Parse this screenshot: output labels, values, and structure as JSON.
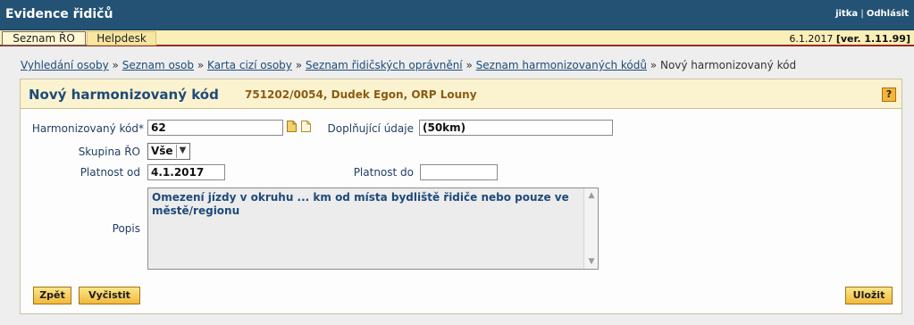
{
  "app": {
    "title": "Evidence řidičů",
    "user": "jitka",
    "separator": "|",
    "logout_label": "Odhlásit"
  },
  "menu": {
    "items": [
      {
        "label": "Seznam ŘO",
        "active": true
      },
      {
        "label": "Helpdesk",
        "active": false
      }
    ],
    "date": "6.1.2017",
    "version": "[ver. 1.11.99]"
  },
  "breadcrumb": {
    "links": [
      "Vyhledání osoby",
      "Seznam osob",
      "Karta cizí osoby",
      "Seznam řidičských oprávnění",
      "Seznam harmonizovaných kódů"
    ],
    "separator": "»",
    "current": "Nový harmonizovaný kód"
  },
  "panel": {
    "title": "Nový harmonizovaný kód",
    "subtitle": "751202/0054, Dudek Egon, ORP Louny",
    "help_label": "?"
  },
  "form": {
    "harmonized_code": {
      "label": "Harmonizovaný kód*",
      "value": "62"
    },
    "extra_info": {
      "label": "Doplňující údaje",
      "value": "(50km)"
    },
    "group": {
      "label": "Skupina ŘO",
      "value": "Vše"
    },
    "valid_from": {
      "label": "Platnost od",
      "value": "4.1.2017"
    },
    "valid_to": {
      "label": "Platnost do",
      "value": ""
    },
    "description": {
      "label": "Popis",
      "value": "Omezení jízdy v okruhu ... km od místa bydliště řidiče nebo pouze ve městě/regionu"
    }
  },
  "buttons": {
    "back": "Zpět",
    "clear": "Vyčistit",
    "save": "Uložit"
  },
  "colors": {
    "topbar": "#245274",
    "menubar": "#fbefb8",
    "accent_red": "#9b2a22",
    "link": "#1d4b79",
    "subtitle": "#8a5c13",
    "button": "#f1b93c"
  }
}
